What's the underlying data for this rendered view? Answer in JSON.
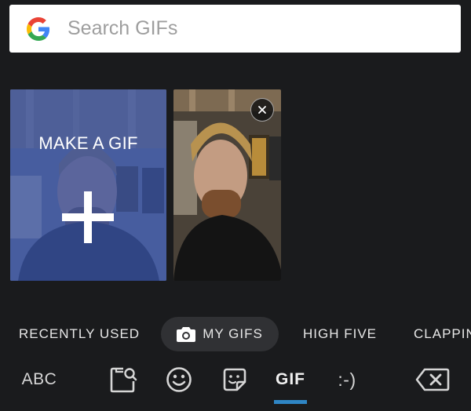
{
  "search": {
    "placeholder": "Search GIFs"
  },
  "tiles": {
    "make_gif_label": "MAKE A GIF"
  },
  "categories": [
    {
      "label": "RECENTLY USED",
      "selected": false
    },
    {
      "label": "MY GIFS",
      "selected": true
    },
    {
      "label": "HIGH FIVE",
      "selected": false
    },
    {
      "label": "CLAPPING",
      "selected": false
    }
  ],
  "toolbar": {
    "abc_label": "ABC",
    "gif_label": "GIF",
    "emoticon_label": ":-)",
    "icons": [
      "gif-search-icon",
      "emoji-icon",
      "sticker-icon",
      "backspace-icon"
    ],
    "active": "GIF"
  },
  "colors": {
    "background": "#1a1b1d",
    "accent": "#2f86c5",
    "chip_selected": "#303134",
    "make_gif_overlay": "#3755aa"
  }
}
